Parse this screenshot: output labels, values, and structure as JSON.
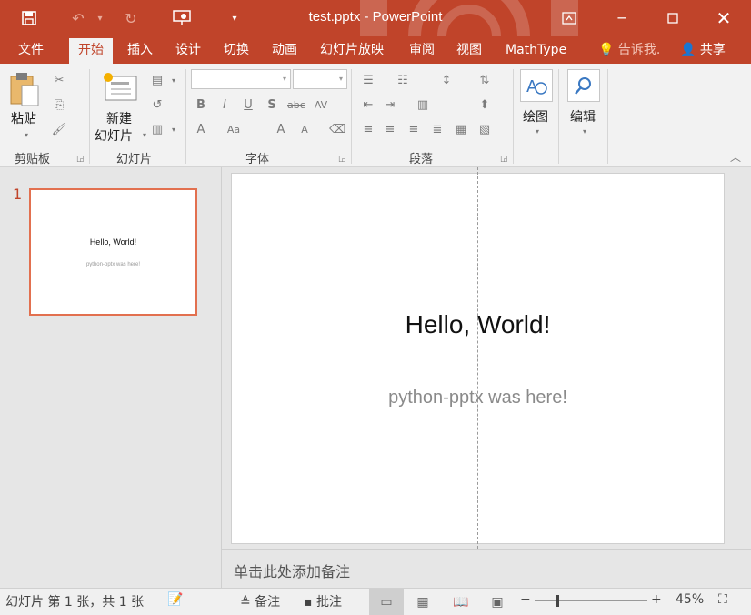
{
  "titlebar": {
    "title": "test.pptx - PowerPoint",
    "icons": [
      "save-icon",
      "undo-icon",
      "redo-icon",
      "start-from-beginning-icon",
      "customize-qat-icon"
    ],
    "window_icons": [
      "ribbon-display-options-icon",
      "minimize-icon",
      "maximize-icon",
      "close-icon"
    ]
  },
  "tabs": [
    {
      "label": "文件"
    },
    {
      "label": "开始"
    },
    {
      "label": "插入"
    },
    {
      "label": "设计"
    },
    {
      "label": "切换"
    },
    {
      "label": "动画"
    },
    {
      "label": "幻灯片放映"
    },
    {
      "label": "审阅"
    },
    {
      "label": "视图"
    },
    {
      "label": "MathType"
    }
  ],
  "tell_me": "告诉我.",
  "share": "共享",
  "ribbon": {
    "clipboard": {
      "paste": "粘贴",
      "label": "剪贴板"
    },
    "slides": {
      "new_slide_line1": "新建",
      "new_slide_line2": "幻灯片",
      "label": "幻灯片"
    },
    "font": {
      "label": "字体",
      "font_name": "",
      "font_size": ""
    },
    "paragraph": {
      "label": "段落"
    },
    "drawing": {
      "label": "绘图"
    },
    "editing": {
      "label": "编辑"
    }
  },
  "thumbnail": {
    "number": "1",
    "title": "Hello, World!",
    "subtitle": "python-pptx was here!"
  },
  "slide": {
    "title": "Hello, World!",
    "subtitle": "python-pptx was here!"
  },
  "notes_placeholder": "单击此处添加备注",
  "statusbar": {
    "slide_info": "幻灯片 第 1 张，共 1 张",
    "notes": "备注",
    "comments": "批注",
    "zoom": "45%"
  },
  "colors": {
    "accent": "#c0442a",
    "selection": "#e2704f"
  }
}
